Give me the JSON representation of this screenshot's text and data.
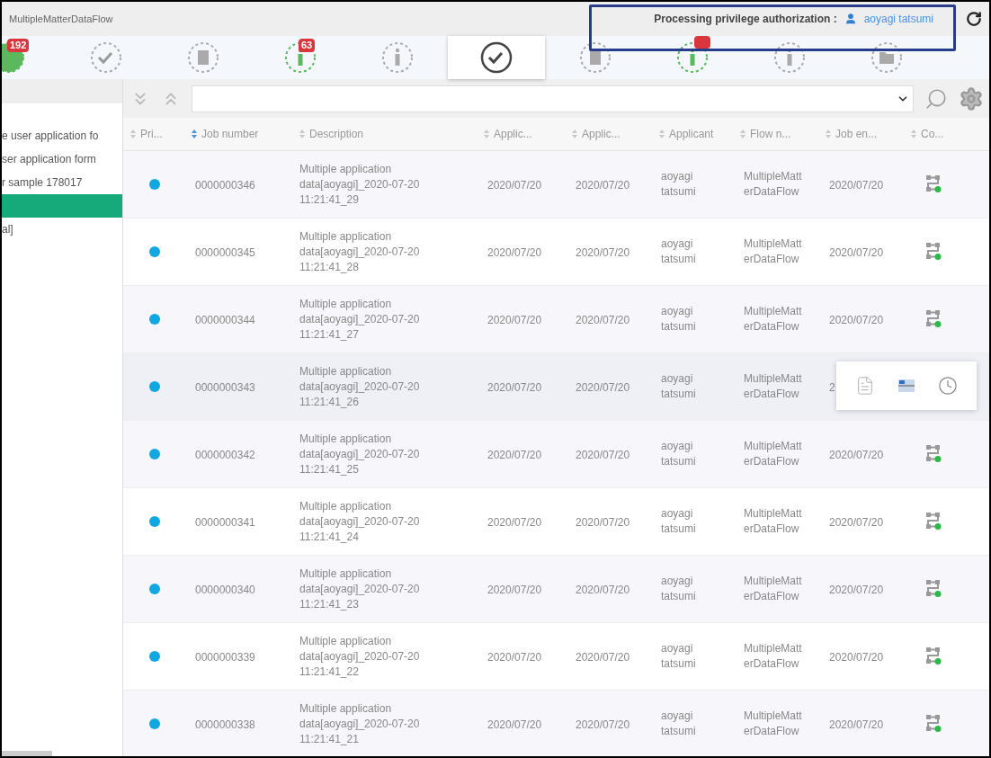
{
  "window": {
    "title": "MultipleMatterDataFlow"
  },
  "authorization": {
    "label": "Processing privilege authorization :",
    "user": "aoyagi tatsumi"
  },
  "tabs": [
    {
      "kind": "circle",
      "badge": "192",
      "highlighted": true,
      "selected": false
    },
    {
      "kind": "check",
      "highlighted": false,
      "selected": false
    },
    {
      "kind": "doc",
      "highlighted": false,
      "selected": false
    },
    {
      "kind": "info",
      "badge": "63",
      "highlighted": true,
      "selected": false
    },
    {
      "kind": "info",
      "highlighted": false,
      "selected": false
    },
    {
      "kind": "check",
      "highlighted": false,
      "selected": true
    },
    {
      "kind": "doc",
      "highlighted": false,
      "selected": false
    },
    {
      "kind": "info",
      "alert": true,
      "highlighted": true,
      "selected": false
    },
    {
      "kind": "info",
      "highlighted": false,
      "selected": false
    },
    {
      "kind": "folder",
      "highlighted": false,
      "selected": false
    }
  ],
  "sidebar": {
    "items": [
      {
        "label": "e user application fo",
        "selected": false
      },
      {
        "label": "ser application form",
        "selected": false
      },
      {
        "label": "r sample 178017",
        "selected": false
      },
      {
        "selected": true
      },
      {
        "label": "al]",
        "selected": false
      }
    ]
  },
  "table": {
    "columns": [
      {
        "label": "Pri...",
        "sorted": false
      },
      {
        "label": "Job number",
        "sorted": true
      },
      {
        "label": "Description",
        "sorted": false
      },
      {
        "label": "Applic...",
        "sorted": false
      },
      {
        "label": "Applic...",
        "sorted": false
      },
      {
        "label": "Applicant",
        "sorted": false
      },
      {
        "label": "Flow n...",
        "sorted": false
      },
      {
        "label": "Job en...",
        "sorted": false
      },
      {
        "label": "Co...",
        "sorted": false
      }
    ],
    "rows": [
      {
        "job_number": "0000000346",
        "description": "Multiple application data[aoyagi]_2020-07-20 11:21:41_29",
        "date_1": "2020/07/20",
        "date_2": "2020/07/20",
        "applicant": "aoyagi tatsumi",
        "flow": "MultipleMatterDataFlow",
        "job_end": "2020/07/20",
        "hovered": false
      },
      {
        "job_number": "0000000345",
        "description": "Multiple application data[aoyagi]_2020-07-20 11:21:41_28",
        "date_1": "2020/07/20",
        "date_2": "2020/07/20",
        "applicant": "aoyagi tatsumi",
        "flow": "MultipleMatterDataFlow",
        "job_end": "2020/07/20",
        "hovered": false
      },
      {
        "job_number": "0000000344",
        "description": "Multiple application data[aoyagi]_2020-07-20 11:21:41_27",
        "date_1": "2020/07/20",
        "date_2": "2020/07/20",
        "applicant": "aoyagi tatsumi",
        "flow": "MultipleMatterDataFlow",
        "job_end": "2020/07/20",
        "hovered": false
      },
      {
        "job_number": "0000000343",
        "description": "Multiple application data[aoyagi]_2020-07-20 11:21:41_26",
        "date_1": "2020/07/20",
        "date_2": "2020/07/20",
        "applicant": "aoyagi tatsumi",
        "flow": "MultipleMatterDataFlow",
        "job_end": "2",
        "hovered": true
      },
      {
        "job_number": "0000000342",
        "description": "Multiple application data[aoyagi]_2020-07-20 11:21:41_25",
        "date_1": "2020/07/20",
        "date_2": "2020/07/20",
        "applicant": "aoyagi tatsumi",
        "flow": "MultipleMatterDataFlow",
        "job_end": "2020/07/20",
        "hovered": false
      },
      {
        "job_number": "0000000341",
        "description": "Multiple application data[aoyagi]_2020-07-20 11:21:41_24",
        "date_1": "2020/07/20",
        "date_2": "2020/07/20",
        "applicant": "aoyagi tatsumi",
        "flow": "MultipleMatterDataFlow",
        "job_end": "2020/07/20",
        "hovered": false
      },
      {
        "job_number": "0000000340",
        "description": "Multiple application data[aoyagi]_2020-07-20 11:21:41_23",
        "date_1": "2020/07/20",
        "date_2": "2020/07/20",
        "applicant": "aoyagi tatsumi",
        "flow": "MultipleMatterDataFlow",
        "job_end": "2020/07/20",
        "hovered": false
      },
      {
        "job_number": "0000000339",
        "description": "Multiple application data[aoyagi]_2020-07-20 11:21:41_22",
        "date_1": "2020/07/20",
        "date_2": "2020/07/20",
        "applicant": "aoyagi tatsumi",
        "flow": "MultipleMatterDataFlow",
        "job_end": "2020/07/20",
        "hovered": false
      },
      {
        "job_number": "0000000338",
        "description": "Multiple application data[aoyagi]_2020-07-20 11:21:41_21",
        "date_1": "2020/07/20",
        "date_2": "2020/07/20",
        "applicant": "aoyagi tatsumi",
        "flow": "MultipleMatterDataFlow",
        "job_end": "2020/07/20",
        "hovered": false
      }
    ]
  }
}
